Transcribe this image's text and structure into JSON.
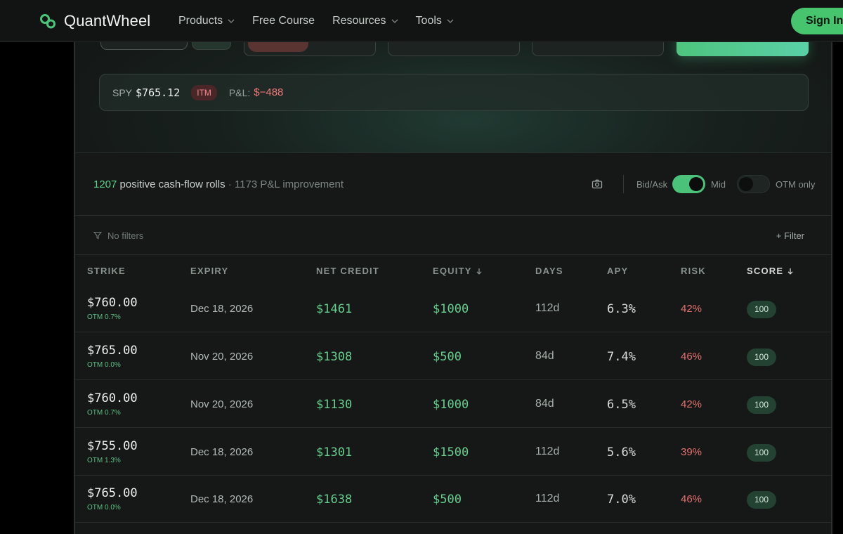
{
  "brand": {
    "name": "QuantWheel"
  },
  "nav": {
    "items": [
      {
        "label": "Products",
        "dropdown": true
      },
      {
        "label": "Free Course",
        "dropdown": false
      },
      {
        "label": "Resources",
        "dropdown": true
      },
      {
        "label": "Tools",
        "dropdown": true
      }
    ],
    "signin_label": "Sign In"
  },
  "quote": {
    "symbol": "SPY",
    "price": "$765.12",
    "status_badge": "ITM",
    "pl_label": "P&L:",
    "pl_value": "$−488"
  },
  "summary": {
    "count": "1207",
    "count_text": "positive cash-flow rolls",
    "secondary": "· 1173 P&L improvement",
    "toggle_bidask_label": "Bid/Ask",
    "toggle_mid_label": "Mid",
    "toggle_otm_label": "OTM only",
    "mid_enabled": true,
    "otm_only_enabled": false
  },
  "filters": {
    "status": "No filters",
    "add_label": "+ Filter"
  },
  "table": {
    "columns": [
      {
        "key": "strike",
        "label": "STRIKE",
        "sorted": false
      },
      {
        "key": "expiry",
        "label": "EXPIRY",
        "sorted": false
      },
      {
        "key": "net_credit",
        "label": "NET CREDIT",
        "sorted": false
      },
      {
        "key": "equity",
        "label": "EQUITY",
        "sorted": true
      },
      {
        "key": "days",
        "label": "DAYS",
        "sorted": false
      },
      {
        "key": "apy",
        "label": "APY",
        "sorted": false
      },
      {
        "key": "risk",
        "label": "RISK",
        "sorted": false
      },
      {
        "key": "score",
        "label": "SCORE",
        "sorted": true
      }
    ],
    "rows": [
      {
        "strike": "$760.00",
        "otm": "OTM 0.7%",
        "expiry": "Dec 18, 2026",
        "net_credit": "$1461",
        "equity": "$1000",
        "days": "112d",
        "apy": "6.3%",
        "risk": "42%",
        "score": "100"
      },
      {
        "strike": "$765.00",
        "otm": "OTM 0.0%",
        "expiry": "Nov 20, 2026",
        "net_credit": "$1308",
        "equity": "$500",
        "days": "84d",
        "apy": "7.4%",
        "risk": "46%",
        "score": "100"
      },
      {
        "strike": "$760.00",
        "otm": "OTM 0.7%",
        "expiry": "Nov 20, 2026",
        "net_credit": "$1130",
        "equity": "$1000",
        "days": "84d",
        "apy": "6.5%",
        "risk": "42%",
        "score": "100"
      },
      {
        "strike": "$755.00",
        "otm": "OTM 1.3%",
        "expiry": "Dec 18, 2026",
        "net_credit": "$1301",
        "equity": "$1500",
        "days": "112d",
        "apy": "5.6%",
        "risk": "39%",
        "score": "100"
      },
      {
        "strike": "$765.00",
        "otm": "OTM 0.0%",
        "expiry": "Dec 18, 2026",
        "net_credit": "$1638",
        "equity": "$500",
        "days": "112d",
        "apy": "7.0%",
        "risk": "46%",
        "score": "100"
      }
    ]
  },
  "colors": {
    "accent": "#46c46e",
    "negative": "#e2716f",
    "background": "#151817"
  }
}
